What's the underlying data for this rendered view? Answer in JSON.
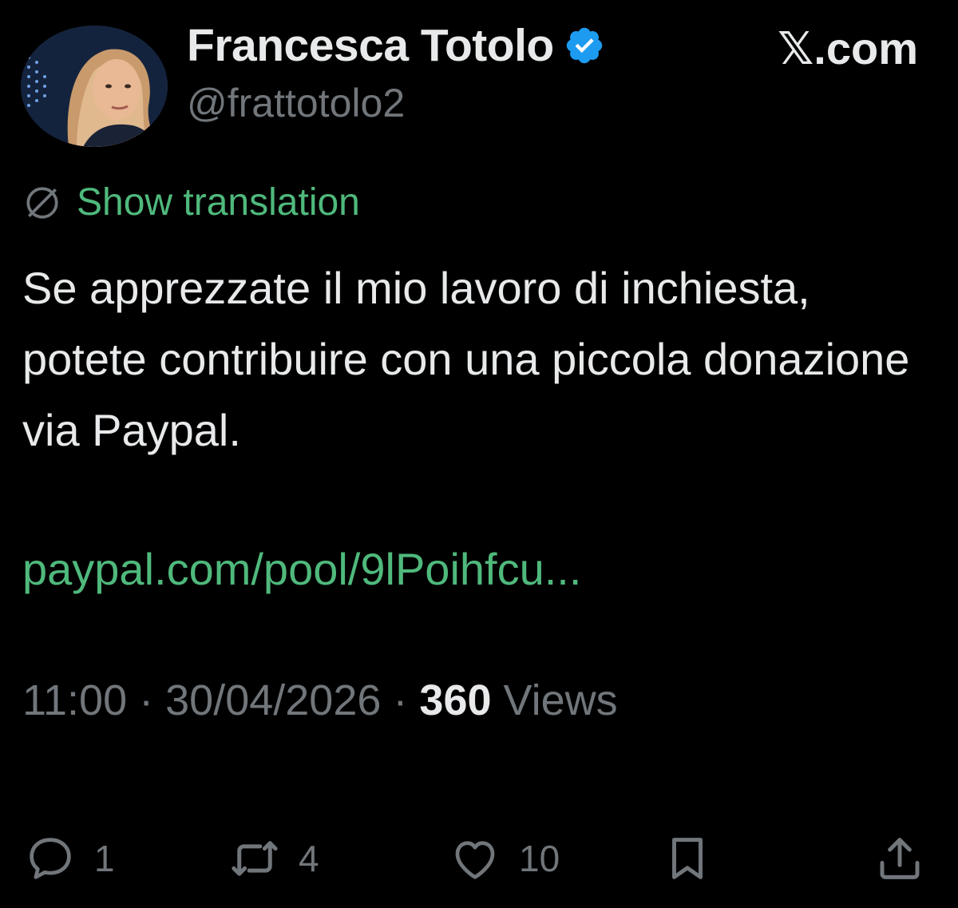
{
  "header": {
    "display_name": "Francesca Totolo",
    "handle": "@frattotolo2",
    "brand": "𝕏.com"
  },
  "translation": {
    "label": "Show translation"
  },
  "tweet": {
    "text": "Se apprezzate il mio lavoro di inchiesta, potete contribuire con una piccola donazione via Paypal.",
    "link": "paypal.com/pool/9lPoihfcu..."
  },
  "meta": {
    "time": "11:00",
    "separator": "·",
    "date": "30/04/2026",
    "views_count": "360",
    "views_label": "Views"
  },
  "actions": {
    "replies": "1",
    "reposts": "4",
    "likes": "10"
  },
  "colors": {
    "background": "#000000",
    "text": "#e7e9ea",
    "muted": "#71767b",
    "accent_green": "#4fb97c",
    "verified_blue": "#1d9bf0"
  }
}
